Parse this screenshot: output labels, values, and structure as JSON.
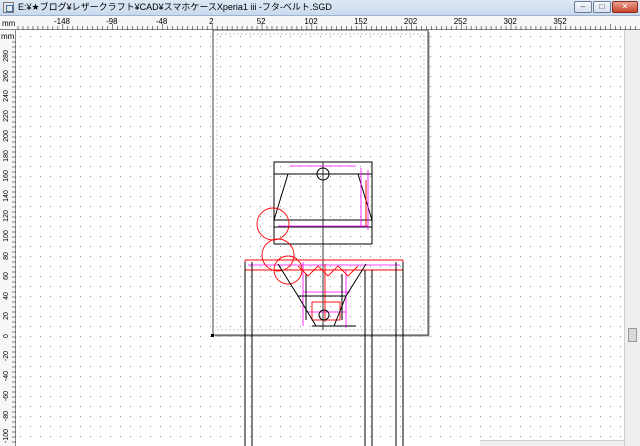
{
  "window": {
    "title": "E:¥★ブログ¥レザークラフト¥CAD¥スマホケースXperia1 iii -フタ-ベルト.SGD",
    "minimize_glyph": "‒",
    "maximize_glyph": "□",
    "close_glyph": "✕"
  },
  "rulers": {
    "unit_top": "mm",
    "unit_left": "mm",
    "top_labels": [
      "-148",
      "-98",
      "-48",
      "2",
      "52",
      "102",
      "152",
      "202",
      "252",
      "302",
      "352"
    ],
    "left_labels": [
      "280",
      "260",
      "240",
      "220",
      "200",
      "180",
      "160",
      "140",
      "120",
      "100",
      "80",
      "60",
      "40",
      "20",
      "0",
      "-20",
      "-40",
      "-60",
      "-80",
      "-100"
    ]
  },
  "colors": {
    "drawing_black": "#000000",
    "drawing_red": "#ff0000",
    "dimension_magenta": "#ff00ff",
    "grid_dot": "#8a8a8a"
  }
}
